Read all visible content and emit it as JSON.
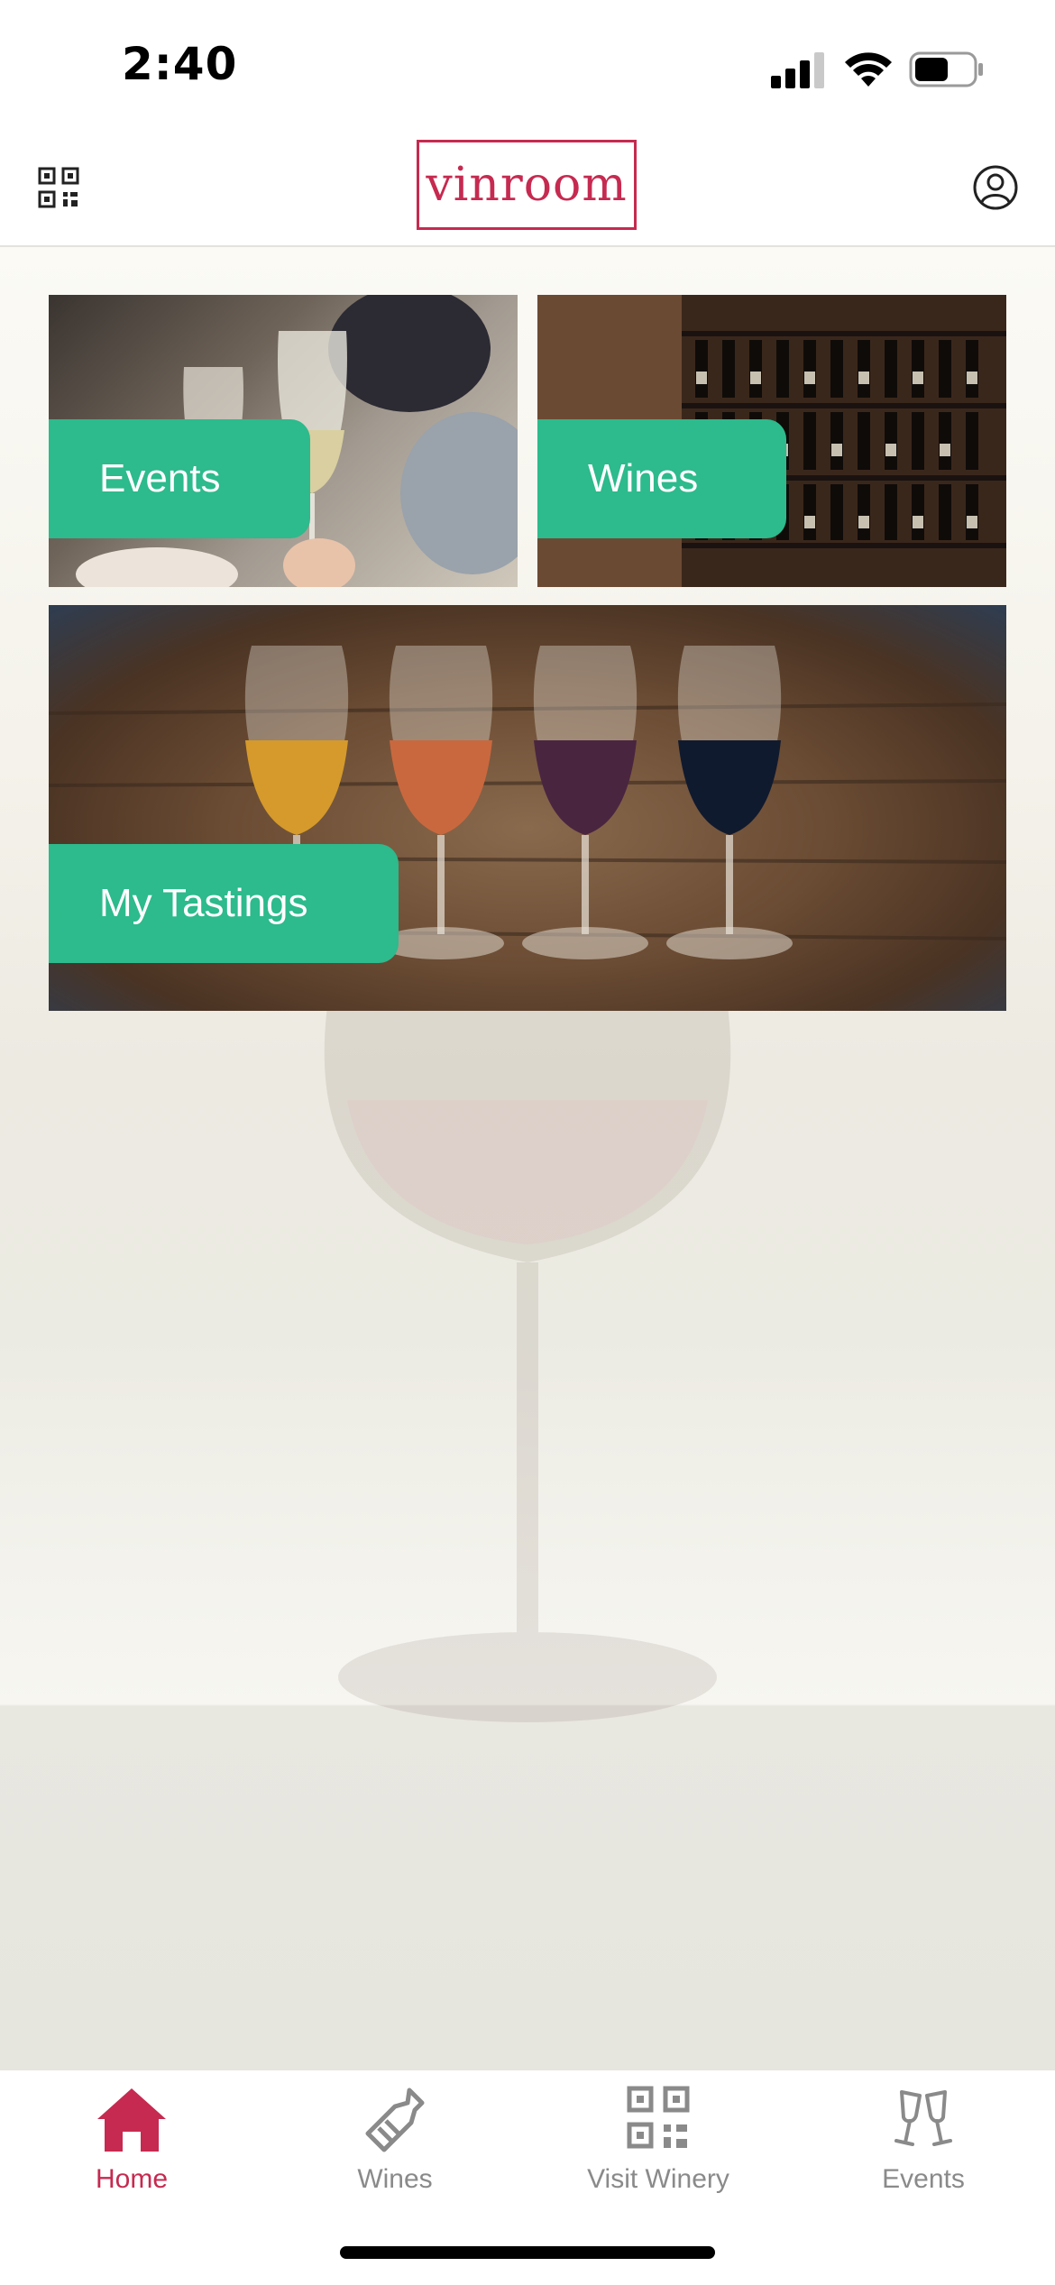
{
  "status_bar": {
    "time": "2:40"
  },
  "header": {
    "logo": "vinroom"
  },
  "tiles": {
    "events": {
      "label": "Events"
    },
    "wines": {
      "label": "Wines"
    },
    "tastings": {
      "label": "My Tastings"
    }
  },
  "tab_bar": {
    "items": [
      {
        "label": "Home",
        "icon": "home-icon",
        "active": true
      },
      {
        "label": "Wines",
        "icon": "wine-bottle-icon",
        "active": false
      },
      {
        "label": "Visit Winery",
        "icon": "qr-code-icon",
        "active": false
      },
      {
        "label": "Events",
        "icon": "cheers-glasses-icon",
        "active": false
      }
    ]
  },
  "colors": {
    "accent": "#c62a50",
    "tile_label": "#2dba8c",
    "inactive": "#8a8a8a"
  }
}
